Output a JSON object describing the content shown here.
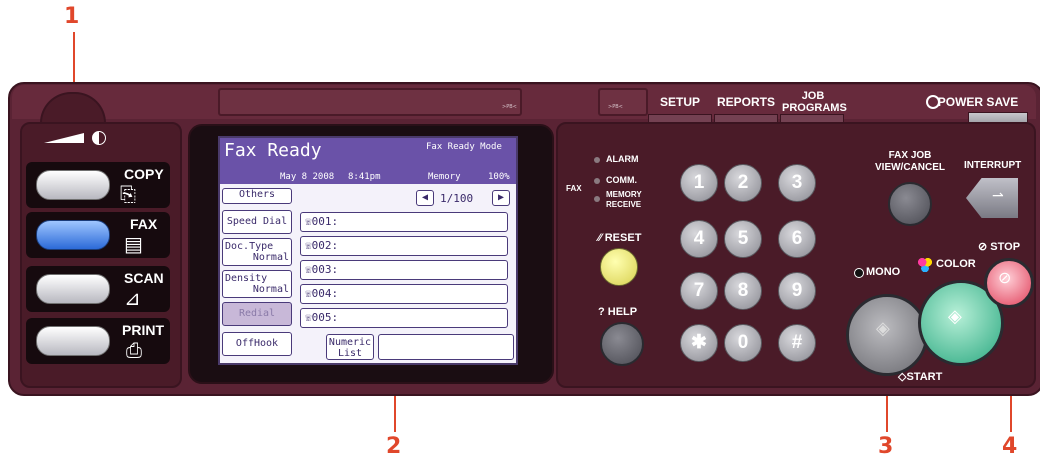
{
  "callouts": [
    "1",
    "2",
    "3",
    "4"
  ],
  "panel": {
    "strip_left_tiny": ">PB<",
    "strip_mid_tiny": ">PB<",
    "tabs": {
      "setup": "SETUP",
      "reports": "REPORTS",
      "job_programs": "JOB\nPROGRAMS",
      "power_save": "POWER SAVE"
    }
  },
  "mode_buttons": [
    {
      "label": "COPY",
      "icon": "copy-icon",
      "active": false
    },
    {
      "label": "FAX",
      "icon": "fax-icon",
      "active": true
    },
    {
      "label": "SCAN",
      "icon": "scan-icon",
      "active": false
    },
    {
      "label": "PRINT",
      "icon": "print-icon",
      "active": false
    }
  ],
  "lcd": {
    "title": "Fax Ready",
    "mode": "Fax Ready Mode",
    "date": "May  8 2008",
    "time": "8:41pm",
    "memory_label": "Memory",
    "memory_value": "100%",
    "page_indicator": "1/100",
    "left_buttons": [
      {
        "line1": "Others",
        "line2": ""
      },
      {
        "line1": "Speed Dial",
        "line2": ""
      },
      {
        "line1": "Doc.Type",
        "line2": "Normal"
      },
      {
        "line1": "Density",
        "line2": "Normal"
      },
      {
        "line1": "Redial",
        "line2": ""
      },
      {
        "line1": "OffHook",
        "line2": ""
      }
    ],
    "entries": [
      "001:",
      "002:",
      "003:",
      "004:",
      "005:"
    ],
    "numeric_list_line1": "Numeric",
    "numeric_list_line2": "List",
    "input_value": ""
  },
  "status": {
    "alarm": "ALARM",
    "comm": "COMM.",
    "memory_receive_1": "MEMORY",
    "memory_receive_2": "RECEIVE",
    "fax": "FAX"
  },
  "controls": {
    "reset": "RESET",
    "help": "HELP",
    "fax_job_1": "FAX JOB",
    "fax_job_2": "VIEW/CANCEL",
    "interrupt": "INTERRUPT",
    "mono": "MONO",
    "color": "COLOR",
    "stop": "STOP",
    "start": "START"
  },
  "keypad": [
    "1",
    "2",
    "3",
    "4",
    "5",
    "6",
    "7",
    "8",
    "9",
    "✱",
    "0",
    "#"
  ],
  "colors": {
    "panel": "#5a2334",
    "callout": "#e0472b",
    "lcd_header": "#6a52a8",
    "fax_active": "#2c6ad8"
  }
}
